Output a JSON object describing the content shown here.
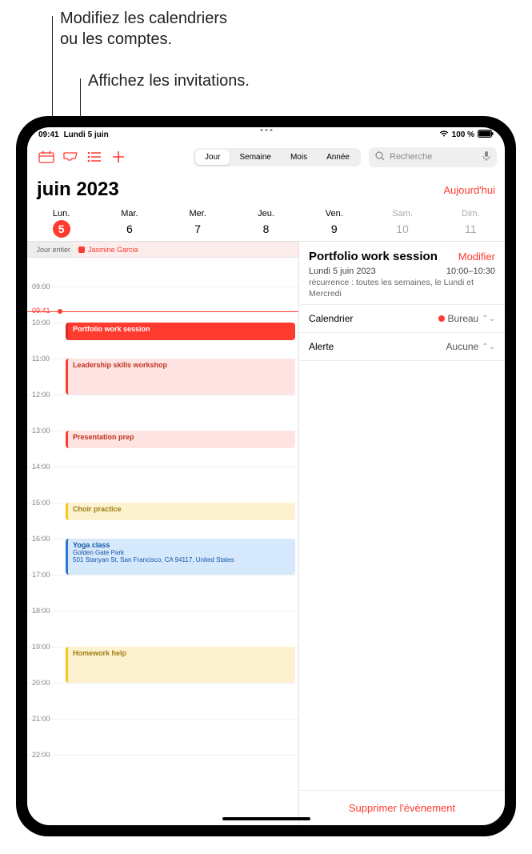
{
  "callouts": {
    "modify": "Modifiez les calendriers\nou les comptes.",
    "invites": "Affichez les invitations."
  },
  "status": {
    "time": "09:41",
    "date": "Lundi 5 juin",
    "battery": "100 %",
    "wifi": "wifi-icon",
    "signal": "signal-icon"
  },
  "viewSeg": {
    "day": "Jour",
    "week": "Semaine",
    "month": "Mois",
    "year": "Année"
  },
  "search": {
    "placeholder": "Recherche"
  },
  "header": {
    "month": "juin 2023",
    "today": "Aujourd'hui"
  },
  "weekdays": [
    {
      "label": "Lun.",
      "num": "5",
      "selected": true
    },
    {
      "label": "Mar.",
      "num": "6"
    },
    {
      "label": "Mer.",
      "num": "7"
    },
    {
      "label": "Jeu.",
      "num": "8"
    },
    {
      "label": "Ven.",
      "num": "9"
    },
    {
      "label": "Sam.",
      "num": "10",
      "weekend": true
    },
    {
      "label": "Dim.",
      "num": "11",
      "weekend": true
    }
  ],
  "allday": {
    "label": "Jour entier",
    "event": "Jasmine Garcia"
  },
  "now": {
    "label": "09:41"
  },
  "hours": [
    "09:00",
    "10:00",
    "11:00",
    "12:00",
    "13:00",
    "14:00",
    "15:00",
    "16:00",
    "17:00",
    "18:00",
    "19:00",
    "20:00",
    "21:00",
    "22:00"
  ],
  "events": {
    "e0": {
      "title": "Portfolio work session"
    },
    "e1": {
      "title": "Leadership skills workshop"
    },
    "e2": {
      "title": "Presentation prep"
    },
    "e3": {
      "title": "Choir practice"
    },
    "e4": {
      "title": "Yoga class",
      "loc": "Golden Gate Park",
      "addr": "501 Stanyan St, San Francisco, CA 94117, United States"
    },
    "e5": {
      "title": "Homework help"
    }
  },
  "detail": {
    "title": "Portfolio work session",
    "edit": "Modifier",
    "date": "Lundi 5 juin 2023",
    "time": "10:00–10:30",
    "recur": "récurrence : toutes les semaines, le Lundi et Mercredi",
    "calLabel": "Calendrier",
    "calValue": "Bureau",
    "alertLabel": "Alerte",
    "alertValue": "Aucune",
    "delete": "Supprimer l'évènement"
  }
}
